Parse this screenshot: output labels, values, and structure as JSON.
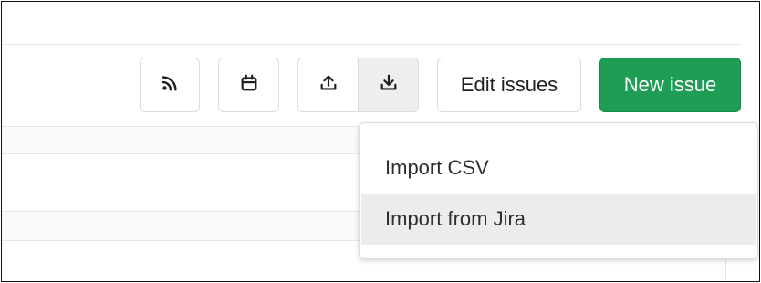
{
  "toolbar": {
    "rss_icon": "rss-icon",
    "calendar_icon": "calendar-icon",
    "export_icon": "upload-icon",
    "import_icon": "download-icon",
    "edit_label": "Edit issues",
    "new_issue_label": "New issue"
  },
  "import_menu": {
    "items": [
      {
        "label": "Import CSV",
        "highlighted": false
      },
      {
        "label": "Import from Jira",
        "highlighted": true
      }
    ]
  },
  "colors": {
    "primary": "#1f9d55",
    "border": "#dcdcde",
    "hover": "#ececec"
  }
}
